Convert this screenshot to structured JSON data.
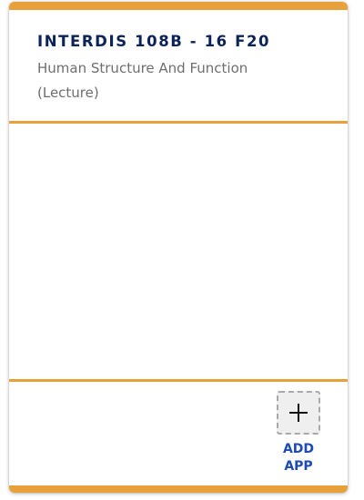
{
  "course": {
    "code": "INTERDIS 108B - 16 F20",
    "title": "Human Structure And Function",
    "section_type": "(Lecture)"
  },
  "footer": {
    "add_app_label": "ADD APP",
    "add_app_icon": "plus-icon"
  },
  "colors": {
    "accent": "#e8a13a",
    "course_code": "#0c2357",
    "course_title": "#6e6e6e",
    "add_app_label": "#1d4ab4"
  }
}
